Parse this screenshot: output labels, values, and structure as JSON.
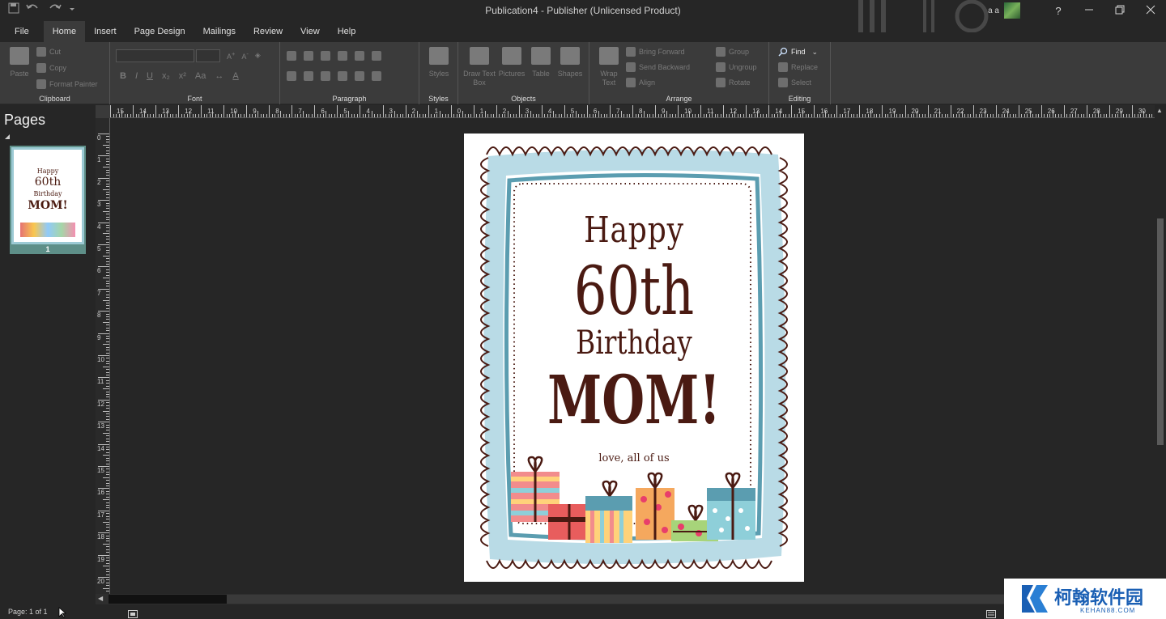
{
  "title_bar": {
    "document_title": "Publication4  -  Publisher (Unlicensed Product)",
    "user_name": "a a",
    "help_label": "?",
    "quick_access": [
      "save-icon",
      "undo-icon",
      "redo-icon",
      "customize-icon"
    ]
  },
  "tabs": [
    "File",
    "Home",
    "Insert",
    "Page Design",
    "Mailings",
    "Review",
    "View",
    "Help"
  ],
  "active_tab": "Home",
  "ribbon": {
    "clipboard": {
      "label": "Clipboard",
      "paste": "Paste",
      "cut": "Cut",
      "copy": "Copy",
      "format_painter": "Format Painter"
    },
    "font": {
      "label": "Font",
      "bold": "B",
      "italic": "I",
      "underline": "U",
      "subscript": "x₂",
      "superscript": "x²",
      "change_case": "Aa",
      "font_color": "A"
    },
    "paragraph": {
      "label": "Paragraph"
    },
    "styles": {
      "label": "Styles",
      "styles_button": "Styles"
    },
    "objects": {
      "label": "Objects",
      "draw_text_box": "Draw Text Box",
      "pictures": "Pictures",
      "table": "Table",
      "shapes": "Shapes"
    },
    "arrange": {
      "label": "Arrange",
      "wrap_text": "Wrap Text",
      "bring_forward": "Bring Forward",
      "send_backward": "Send Backward",
      "align": "Align",
      "group": "Group",
      "ungroup": "Ungroup",
      "rotate": "Rotate"
    },
    "editing": {
      "label": "Editing",
      "find": "Find",
      "replace": "Replace",
      "select": "Select"
    }
  },
  "ruler": {
    "horizontal_ticks": [
      "15",
      "14",
      "13",
      "12",
      "11",
      "10",
      "9",
      "8",
      "7",
      "6",
      "5",
      "4",
      "3",
      "2",
      "1",
      "0",
      "1",
      "2",
      "3",
      "4",
      "5",
      "6",
      "7",
      "8",
      "9",
      "10",
      "11",
      "12",
      "13",
      "14",
      "15",
      "16",
      "17",
      "18",
      "19",
      "20",
      "21",
      "22",
      "23",
      "24",
      "25",
      "26",
      "27",
      "28",
      "29",
      "30"
    ],
    "vertical_ticks": [
      "0",
      "1",
      "2",
      "3",
      "4",
      "5",
      "6",
      "7",
      "8",
      "9",
      "10",
      "11",
      "12",
      "13",
      "14",
      "15",
      "16",
      "17",
      "18",
      "19",
      "20"
    ]
  },
  "pages_pane": {
    "title": "Pages",
    "thumbnail_number": "1"
  },
  "card": {
    "line1": "Happy",
    "line2": "60th",
    "line3": "Birthday",
    "line4": "MOM!",
    "signature": "love, all of us"
  },
  "status_bar": {
    "page_info": "Page: 1 of 1"
  },
  "watermark": {
    "main": "柯翰软件园",
    "sub": "KEHAN88.COM"
  },
  "colors": {
    "ribbon_bg": "#3b3b3b",
    "app_bg": "#262626",
    "card_text": "#4a1a12",
    "border_blue": "#9ccad4"
  }
}
